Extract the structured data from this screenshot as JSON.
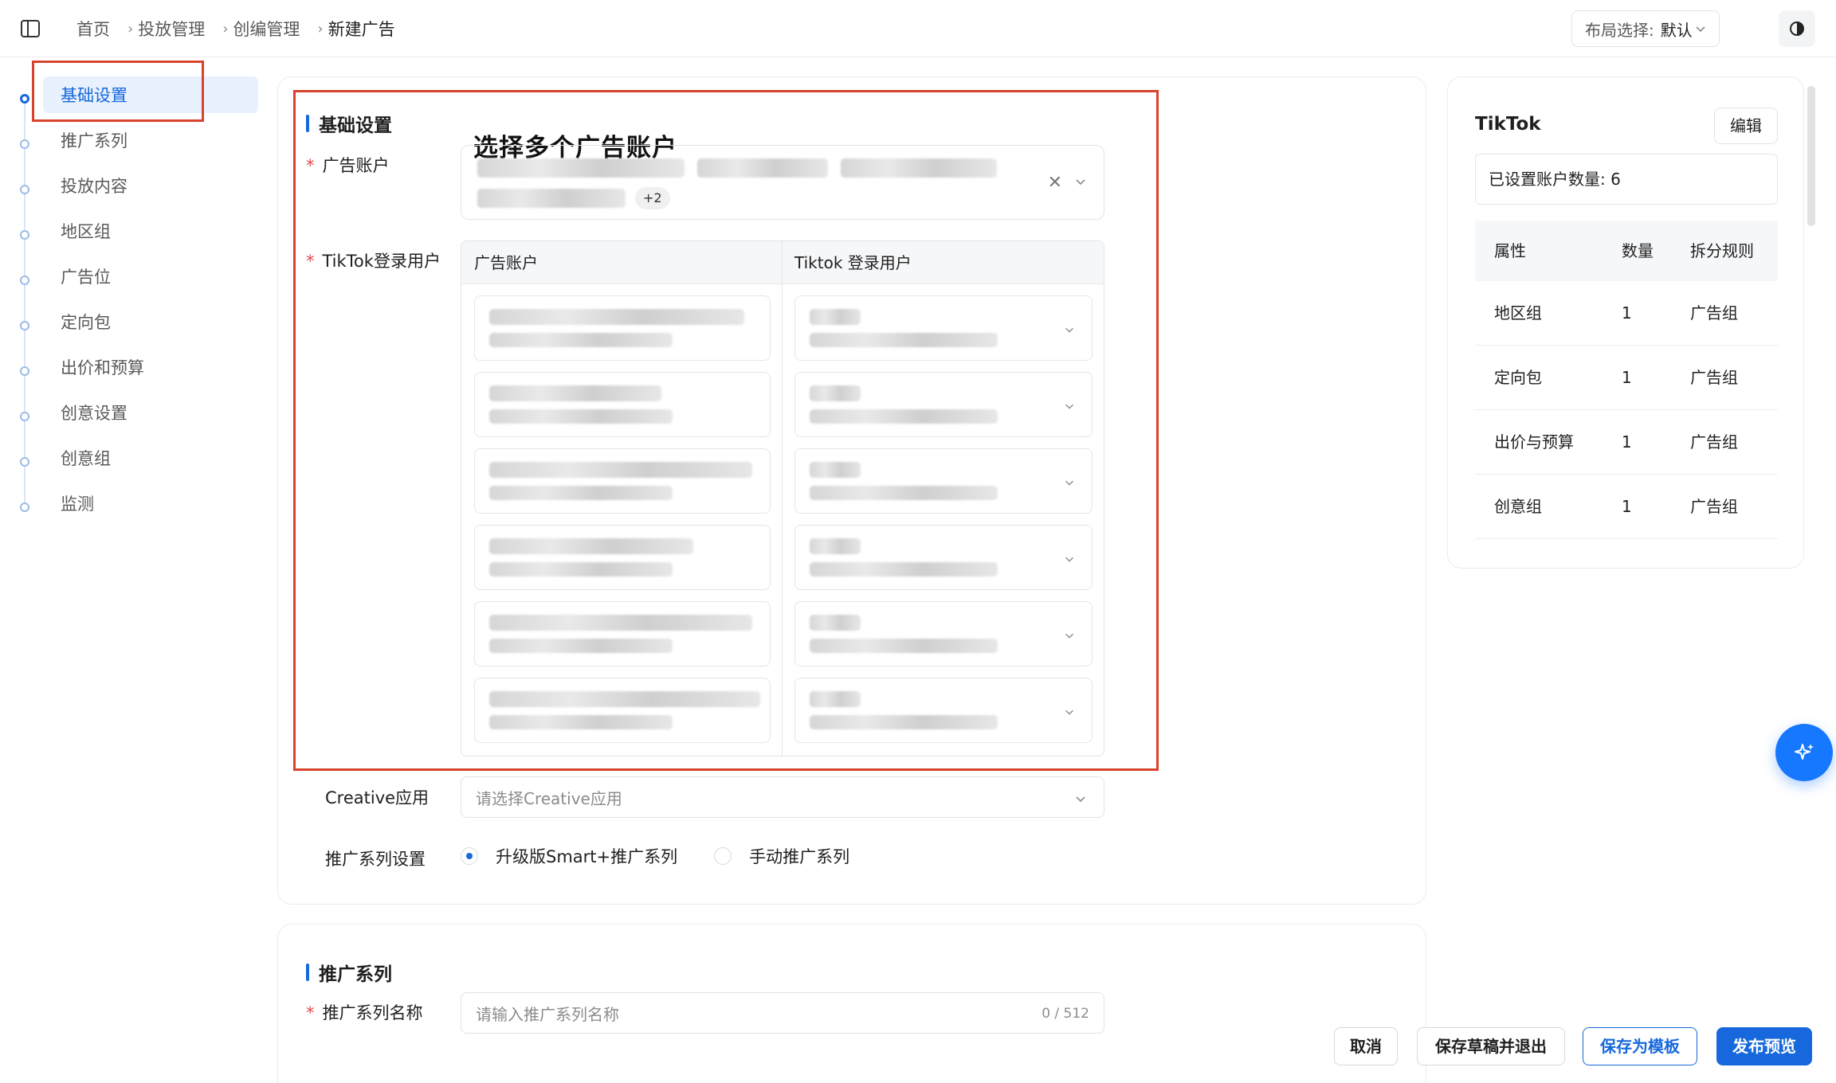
{
  "breadcrumb": [
    "首页",
    "投放管理",
    "创编管理",
    "新建广告"
  ],
  "layout_select": {
    "label": "布局选择:",
    "value": "默认"
  },
  "steps": [
    {
      "label": "基础设置",
      "active": true
    },
    {
      "label": "推广系列"
    },
    {
      "label": "投放内容"
    },
    {
      "label": "地区组"
    },
    {
      "label": "广告位"
    },
    {
      "label": "定向包"
    },
    {
      "label": "出价和预算"
    },
    {
      "label": "创意设置"
    },
    {
      "label": "创意组"
    },
    {
      "label": "监测"
    }
  ],
  "basic": {
    "title": "基础设置",
    "annotation": "选择多个广告账户",
    "account_label": "广告账户",
    "account_more_tag": "+2",
    "login_label": "TikTok登录用户",
    "table_headers": [
      "广告账户",
      "Tiktok 登录用户"
    ],
    "creative_label": "Creative应用",
    "creative_placeholder": "请选择Creative应用",
    "series_setting_label": "推广系列设置",
    "radio_options": [
      "升级版Smart+推广系列",
      "手动推广系列"
    ],
    "radio_selected": "升级版Smart+推广系列"
  },
  "series": {
    "title": "推广系列",
    "name_label": "推广系列名称",
    "name_placeholder": "请输入推广系列名称",
    "name_counter": "0 / 512"
  },
  "summary": {
    "platform": "TikTok",
    "edit_label": "编辑",
    "account_count": "已设置账户数量: 6",
    "headers": [
      "属性",
      "数量",
      "拆分规则"
    ],
    "rows": [
      [
        "地区组",
        "1",
        "广告组"
      ],
      [
        "定向包",
        "1",
        "广告组"
      ],
      [
        "出价与预算",
        "1",
        "广告组"
      ],
      [
        "创意组",
        "1",
        "广告组"
      ]
    ]
  },
  "actions": {
    "cancel": "取消",
    "save_draft": "保存草稿并退出",
    "save_template": "保存为模板",
    "publish": "发布预览"
  },
  "colors": {
    "accent": "#1668dc",
    "annotation": "#d9432d",
    "required": "#e5484d"
  }
}
